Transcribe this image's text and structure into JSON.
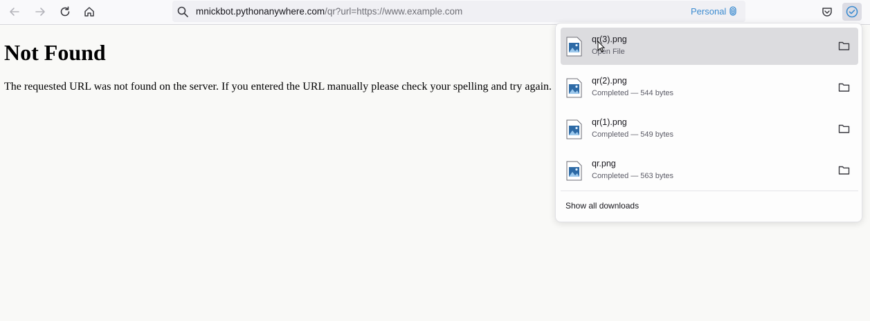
{
  "toolbar": {
    "url_host": "mnickbot.pythonanywhere.com",
    "url_rest": "/qr?url=https://www.example.com",
    "container_label": "Personal",
    "colors": {
      "accent": "#3b8bd0",
      "icon": "#5b5b66"
    }
  },
  "page": {
    "title": "Not Found",
    "message": "The requested URL was not found on the server. If you entered the URL manually please check your spelling and try again."
  },
  "downloads": {
    "items": [
      {
        "name": "qr(3).png",
        "status": "Open File",
        "icon": "image-file-icon"
      },
      {
        "name": "qr(2).png",
        "status": "Completed — 544 bytes",
        "icon": "image-file-icon"
      },
      {
        "name": "qr(1).png",
        "status": "Completed — 549 bytes",
        "icon": "image-file-icon"
      },
      {
        "name": "qr.png",
        "status": "Completed — 563 bytes",
        "icon": "image-file-icon"
      }
    ],
    "show_all_label": "Show all downloads"
  }
}
